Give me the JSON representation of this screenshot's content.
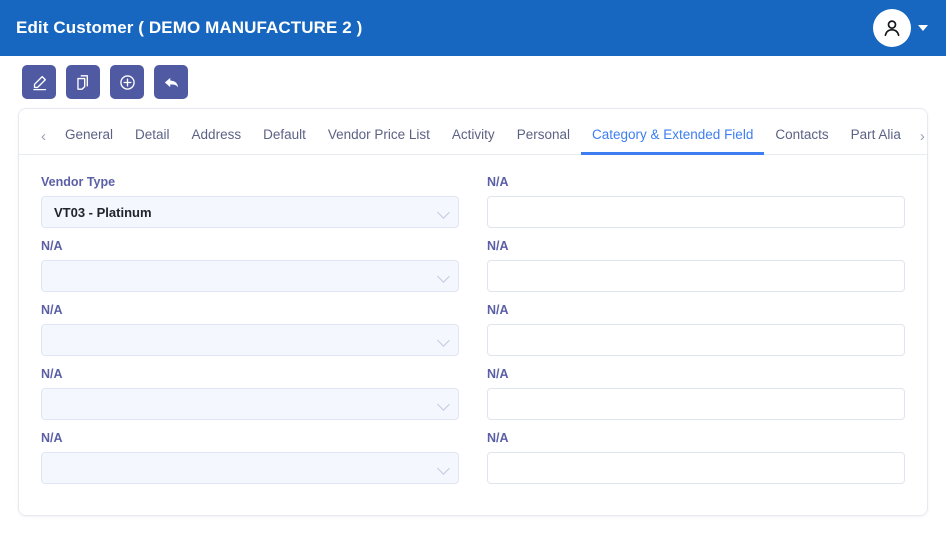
{
  "header": {
    "title": "Edit Customer ( DEMO MANUFACTURE 2 )",
    "avatar_icon": "user-avatar-icon",
    "caret_icon": "chevron-down-icon",
    "background_color": "#1767c0"
  },
  "toolbar": {
    "buttons": [
      {
        "name": "edit-button",
        "icon": "pencil-edit-icon"
      },
      {
        "name": "copy-button",
        "icon": "copy-duplicate-icon"
      },
      {
        "name": "add-button",
        "icon": "plus-circle-icon"
      },
      {
        "name": "back-button",
        "icon": "back-arrow-icon"
      }
    ],
    "button_color": "#4f5aa3"
  },
  "tabs": {
    "scroll_left_icon": "chevron-left-icon",
    "scroll_right_icon": "chevron-right-icon",
    "active_index": 7,
    "accent_color": "#3d7ef0",
    "items": [
      {
        "label": "General"
      },
      {
        "label": "Detail"
      },
      {
        "label": "Address"
      },
      {
        "label": "Default"
      },
      {
        "label": "Vendor Price List"
      },
      {
        "label": "Activity"
      },
      {
        "label": "Personal"
      },
      {
        "label": "Category & Extended Field"
      },
      {
        "label": "Contacts"
      },
      {
        "label": "Part Alia"
      }
    ]
  },
  "form": {
    "left_column": [
      {
        "label": "Vendor Type",
        "value": "VT03 - Platinum",
        "placeholder": "",
        "type": "select"
      },
      {
        "label": "N/A",
        "value": "",
        "placeholder": "",
        "type": "select"
      },
      {
        "label": "N/A",
        "value": "",
        "placeholder": "",
        "type": "select"
      },
      {
        "label": "N/A",
        "value": "",
        "placeholder": "",
        "type": "select"
      },
      {
        "label": "N/A",
        "value": "",
        "placeholder": "",
        "type": "select"
      }
    ],
    "right_column": [
      {
        "label": "N/A",
        "value": "",
        "placeholder": "",
        "type": "text"
      },
      {
        "label": "N/A",
        "value": "",
        "placeholder": "",
        "type": "text"
      },
      {
        "label": "N/A",
        "value": "",
        "placeholder": "",
        "type": "text"
      },
      {
        "label": "N/A",
        "value": "",
        "placeholder": "",
        "type": "text"
      },
      {
        "label": "N/A",
        "value": "",
        "placeholder": "",
        "type": "text"
      }
    ]
  }
}
